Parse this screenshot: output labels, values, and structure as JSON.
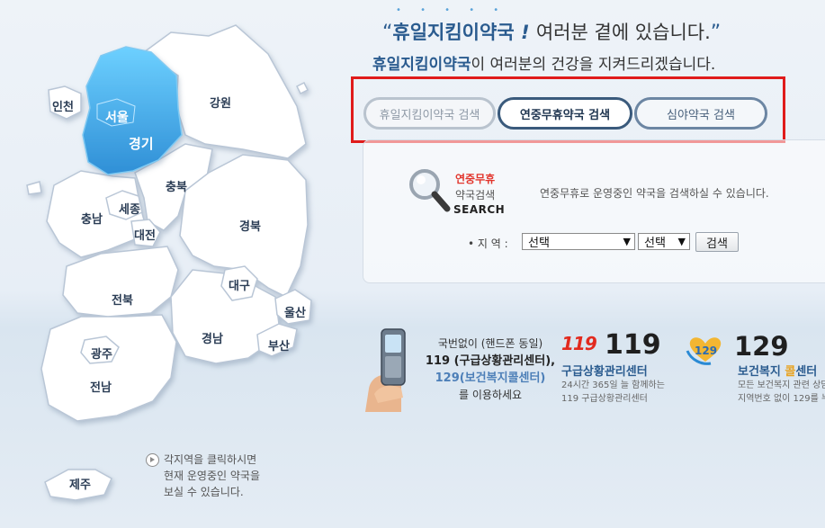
{
  "header": {
    "dots": "• • • • •",
    "slogan_open": "“",
    "slogan_bold": "휴일지킴이약국",
    "slogan_bang": " ! ",
    "slogan_rest": "여러분 곁에 있습니다.",
    "slogan_close": "”",
    "sub_bold": "휴일지킴이약국",
    "sub_rest": "이 여러분의 건강을 지켜드리겠습니다."
  },
  "tabs": [
    {
      "label": "휴일지킴이약국 검색"
    },
    {
      "label": "연중무휴약국 검색"
    },
    {
      "label": "심야약국 검색"
    }
  ],
  "search": {
    "title_red": "연중무휴",
    "title_sub": "약국검색",
    "title_en": "SEARCH",
    "description": "연중무휴로 운영중인 약국을 검색하실 수 있습니다.",
    "region_label": "• 지 역 :",
    "select1_value": "선택",
    "select2_value": "선택",
    "button_label": "검색"
  },
  "map": {
    "regions": {
      "incheon": "인천",
      "seoul": "서울",
      "gyeonggi": "경기",
      "gangwon": "강원",
      "chungbuk": "충북",
      "chungnam": "충남",
      "sejong": "세종",
      "daejeon": "대전",
      "gyeongbuk": "경북",
      "daegu": "대구",
      "jeonbuk": "전북",
      "ulsan": "울산",
      "gyeongnam": "경남",
      "busan": "부산",
      "gwangju": "광주",
      "jeonnam": "전남",
      "jeju": "제주"
    },
    "note_line1": "각지역을 클릭하시면",
    "note_line2": "현재 운영중인 약국을",
    "note_line3": "보실 수 있습니다."
  },
  "info": {
    "line1": "국번없이 (핸드폰 동일)",
    "line2": "119 (구급상황관리센터),",
    "line3": "129(보건복지콜센터)",
    "line4": "를 이용하세요",
    "logo119": "119",
    "num119": "119",
    "title119": "구급상황관리센터",
    "desc119_1": "24시간 365일 늘 함께하는",
    "desc119_2": "119 구급상황관리센터",
    "num129": "129",
    "title129_a": "보건복지 ",
    "title129_b": "콜",
    "title129_c": "센터",
    "desc129_1": "모든 보건복지 관련 상담",
    "desc129_2": "지역번호 없이 129를 누"
  },
  "colors": {
    "highlight_box": "#e01b1b",
    "selected_region": "#3fa6e3",
    "accent_blue": "#2a5b8f",
    "red_text": "#e2342b"
  }
}
